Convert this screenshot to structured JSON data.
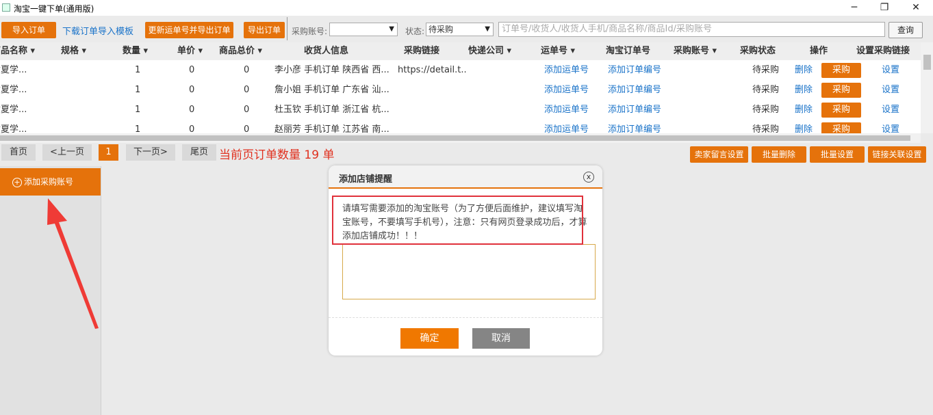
{
  "window": {
    "title": "淘宝一键下单(通用版)",
    "min": "─",
    "restore": "❐",
    "close": "✕"
  },
  "toolbar": {
    "import_order": "导入订单",
    "download_template": "下载订单导入模板",
    "update_export": "更新运单号并导出订单",
    "export_order": "导出订单",
    "account_label": "采购账号:",
    "account_value": "",
    "status_label": "状态:",
    "status_value": "待采购",
    "search_placeholder": "订单号/收货人/收货人手机/商品名称/商品Id/采购账号",
    "query": "查询"
  },
  "table": {
    "headers": [
      "商品名称 ▾",
      "规格 ▾",
      "数量 ▾",
      "单价 ▾",
      "商品总价 ▾",
      "收货人信息",
      "采购链接",
      "快递公司 ▾",
      "运单号 ▾",
      "淘宝订单号",
      "采购账号 ▾",
      "采购状态",
      "操作",
      "设置采购链接"
    ],
    "rows": [
      {
        "name": "女夏学...",
        "qty": "1",
        "price": "0",
        "total": "0",
        "receiver": "李小彦 手机订单 陕西省 西...",
        "link": "https://detail.t...",
        "tracking": "添加运单号",
        "tb_order": "添加订单编号",
        "status": "待采购",
        "del": "删除",
        "buy": "采购",
        "set": "设置"
      },
      {
        "name": "女夏学...",
        "qty": "1",
        "price": "0",
        "total": "0",
        "receiver": "詹小姐 手机订单 广东省 汕...",
        "link": "",
        "tracking": "添加运单号",
        "tb_order": "添加订单编号",
        "status": "待采购",
        "del": "删除",
        "buy": "采购",
        "set": "设置"
      },
      {
        "name": "女夏学...",
        "qty": "1",
        "price": "0",
        "total": "0",
        "receiver": "杜玉钦 手机订单 浙江省 杭...",
        "link": "",
        "tracking": "添加运单号",
        "tb_order": "添加订单编号",
        "status": "待采购",
        "del": "删除",
        "buy": "采购",
        "set": "设置"
      },
      {
        "name": "女夏学...",
        "qty": "1",
        "price": "0",
        "total": "0",
        "receiver": "赵丽芳 手机订单 江苏省 南...",
        "link": "",
        "tracking": "添加运单号",
        "tb_order": "添加订单编号",
        "status": "待采购",
        "del": "删除",
        "buy": "采购",
        "set": "设置"
      }
    ]
  },
  "pager": {
    "first": "首页",
    "prev": "<上一页",
    "page": "1",
    "next": "下一页>",
    "last": "尾页",
    "count_text": "当前页订单数量 19 单",
    "seller_note": "卖家留言设置",
    "batch_delete": "批量删除",
    "batch_set": "批量设置",
    "link_set": "链接关联设置"
  },
  "sidebar": {
    "add_account": "添加采购账号"
  },
  "dialog": {
    "title": "添加店铺提醒",
    "close": "x",
    "message": "请填写需要添加的淘宝账号（为了方便后面维护，建议填写淘宝账号，不要填写手机号），注意：只有网页登录成功后，才算添加店铺成功！！！",
    "ok": "确定",
    "cancel": "取消"
  }
}
